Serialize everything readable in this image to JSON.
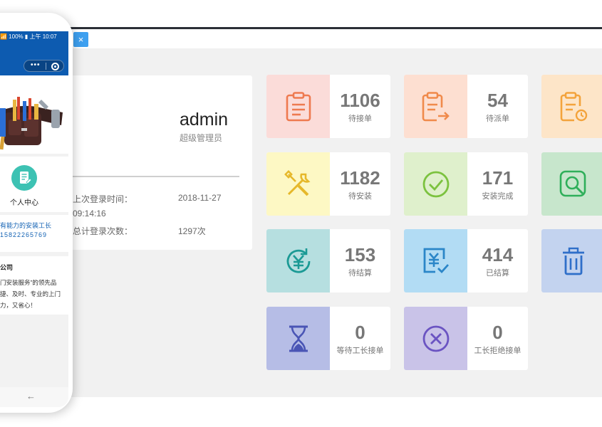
{
  "tab": {
    "close_label": "×"
  },
  "profile": {
    "name": "admin",
    "role": "超级管理员",
    "last_login_label": "上次登录时间：",
    "last_login_date": "2018-11-27",
    "last_login_time": "09:14:16",
    "total_logins_label": "总计登录次数：",
    "total_logins_value": "1297次"
  },
  "tiles": [
    {
      "value": "1106",
      "label": "待接单",
      "icon": "clipboard-icon",
      "bg": "#fbdcd9",
      "color": "#ee7a50"
    },
    {
      "value": "54",
      "label": "待派单",
      "icon": "clipboard-forward-icon",
      "bg": "#fddfd1",
      "color": "#f08a4b"
    },
    {
      "value": "",
      "label": "",
      "icon": "clipboard-clock-icon",
      "bg": "#fde5c8",
      "color": "#f3a33c"
    },
    {
      "value": "1182",
      "label": "待安装",
      "icon": "tools-icon",
      "bg": "#fdf8c4",
      "color": "#e6b82a"
    },
    {
      "value": "171",
      "label": "安装完成",
      "icon": "check-circle-icon",
      "bg": "#dff0cc",
      "color": "#7cc23f"
    },
    {
      "value": "",
      "label": "",
      "icon": "search-square-icon",
      "bg": "#c7e6cc",
      "color": "#2faf5a"
    },
    {
      "value": "153",
      "label": "待结算",
      "icon": "yuen-refresh-icon",
      "bg": "#b6dfe0",
      "color": "#1b9a95"
    },
    {
      "value": "414",
      "label": "已结算",
      "icon": "yuen-check-icon",
      "bg": "#b2dcf4",
      "color": "#2b86c8"
    },
    {
      "value": "",
      "label": "",
      "icon": "trash-icon",
      "bg": "#c3d3ef",
      "color": "#2f6fc9"
    },
    {
      "value": "0",
      "label": "等待工长接单",
      "icon": "hourglass-icon",
      "bg": "#b6bde6",
      "color": "#4a55b5"
    },
    {
      "value": "0",
      "label": "工长拒绝接单",
      "icon": "cancel-circle-icon",
      "bg": "#c9c3e8",
      "color": "#6b54c2"
    }
  ],
  "phone": {
    "status_text": "📶 100% ▮ 上午 10:07",
    "capsule_dots": "•••",
    "menu_label": "个人中心",
    "contact_line1": "有能力的安装工长",
    "contact_line2": "15822265769",
    "company_title": "公司",
    "company_line1": "门安装服务”的领先品",
    "company_line2": "捷、及时、专业的上门",
    "company_line3": "力，又省心！",
    "back_glyph": "←"
  }
}
